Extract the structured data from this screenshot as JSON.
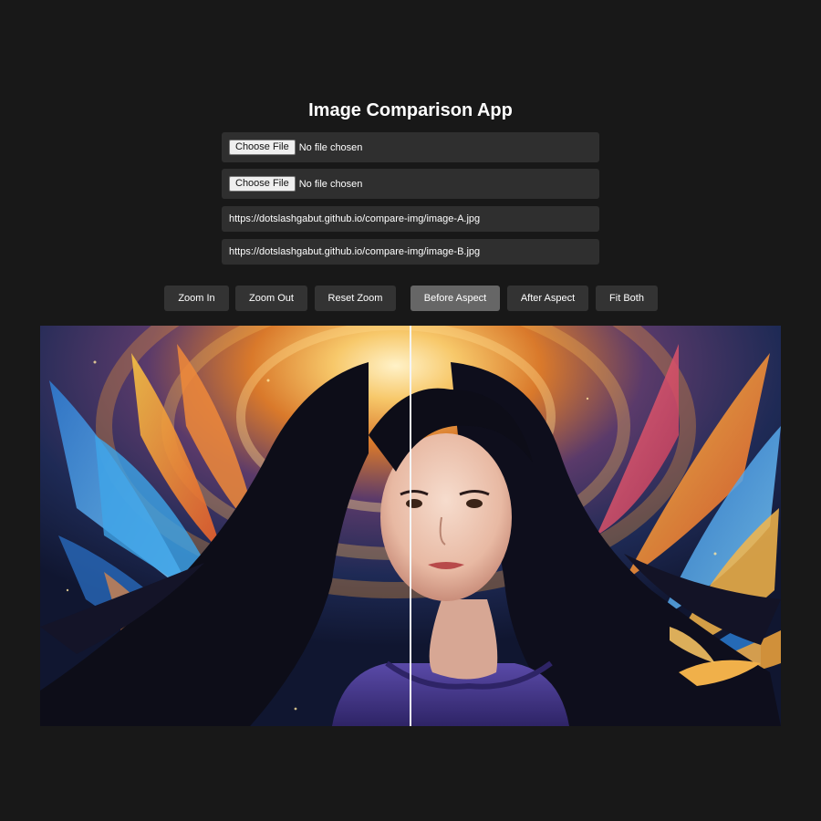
{
  "app": {
    "title": "Image Comparison App"
  },
  "inputs": {
    "file_a": {
      "button_label": "Choose File",
      "status": "No file chosen"
    },
    "file_b": {
      "button_label": "Choose File",
      "status": "No file chosen"
    },
    "url_a": {
      "value": "https://dotslashgabut.github.io/compare-img/image-A.jpg"
    },
    "url_b": {
      "value": "https://dotslashgabut.github.io/compare-img/image-B.jpg"
    }
  },
  "toolbar": {
    "zoom_in": "Zoom In",
    "zoom_out": "Zoom Out",
    "reset_zoom": "Reset Zoom",
    "before_aspect": "Before Aspect",
    "after_aspect": "After Aspect",
    "fit_both": "Fit Both",
    "active_button": "before_aspect"
  },
  "viewer": {
    "slider_position": 0.5
  },
  "colors": {
    "background": "#181818",
    "field_background": "#2f2f2f",
    "button_background": "#333333",
    "button_active": "#666666"
  }
}
